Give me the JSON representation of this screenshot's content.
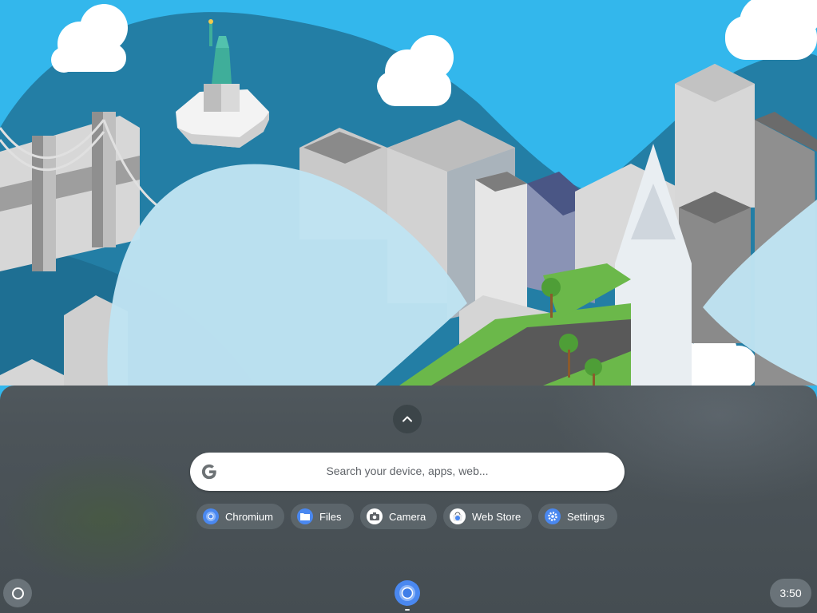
{
  "launcher": {
    "search_placeholder": "Search your device, apps, web...",
    "suggested_apps": [
      {
        "label": "Chromium",
        "icon": "chromium-icon"
      },
      {
        "label": "Files",
        "icon": "files-icon"
      },
      {
        "label": "Camera",
        "icon": "camera-icon"
      },
      {
        "label": "Web Store",
        "icon": "web-store-icon"
      },
      {
        "label": "Settings",
        "icon": "settings-icon"
      }
    ]
  },
  "shelf": {
    "launcher_icon": "launcher-circle-icon",
    "pinned": [
      {
        "name": "Chromium",
        "icon": "chromium-icon"
      }
    ],
    "time": "3:50"
  },
  "colors": {
    "sky": "#33b7ec",
    "hill": "#237ea5",
    "launcher_bg": "#545c61",
    "chip_bg": "#5f696e",
    "accent": "#4a88f0"
  }
}
